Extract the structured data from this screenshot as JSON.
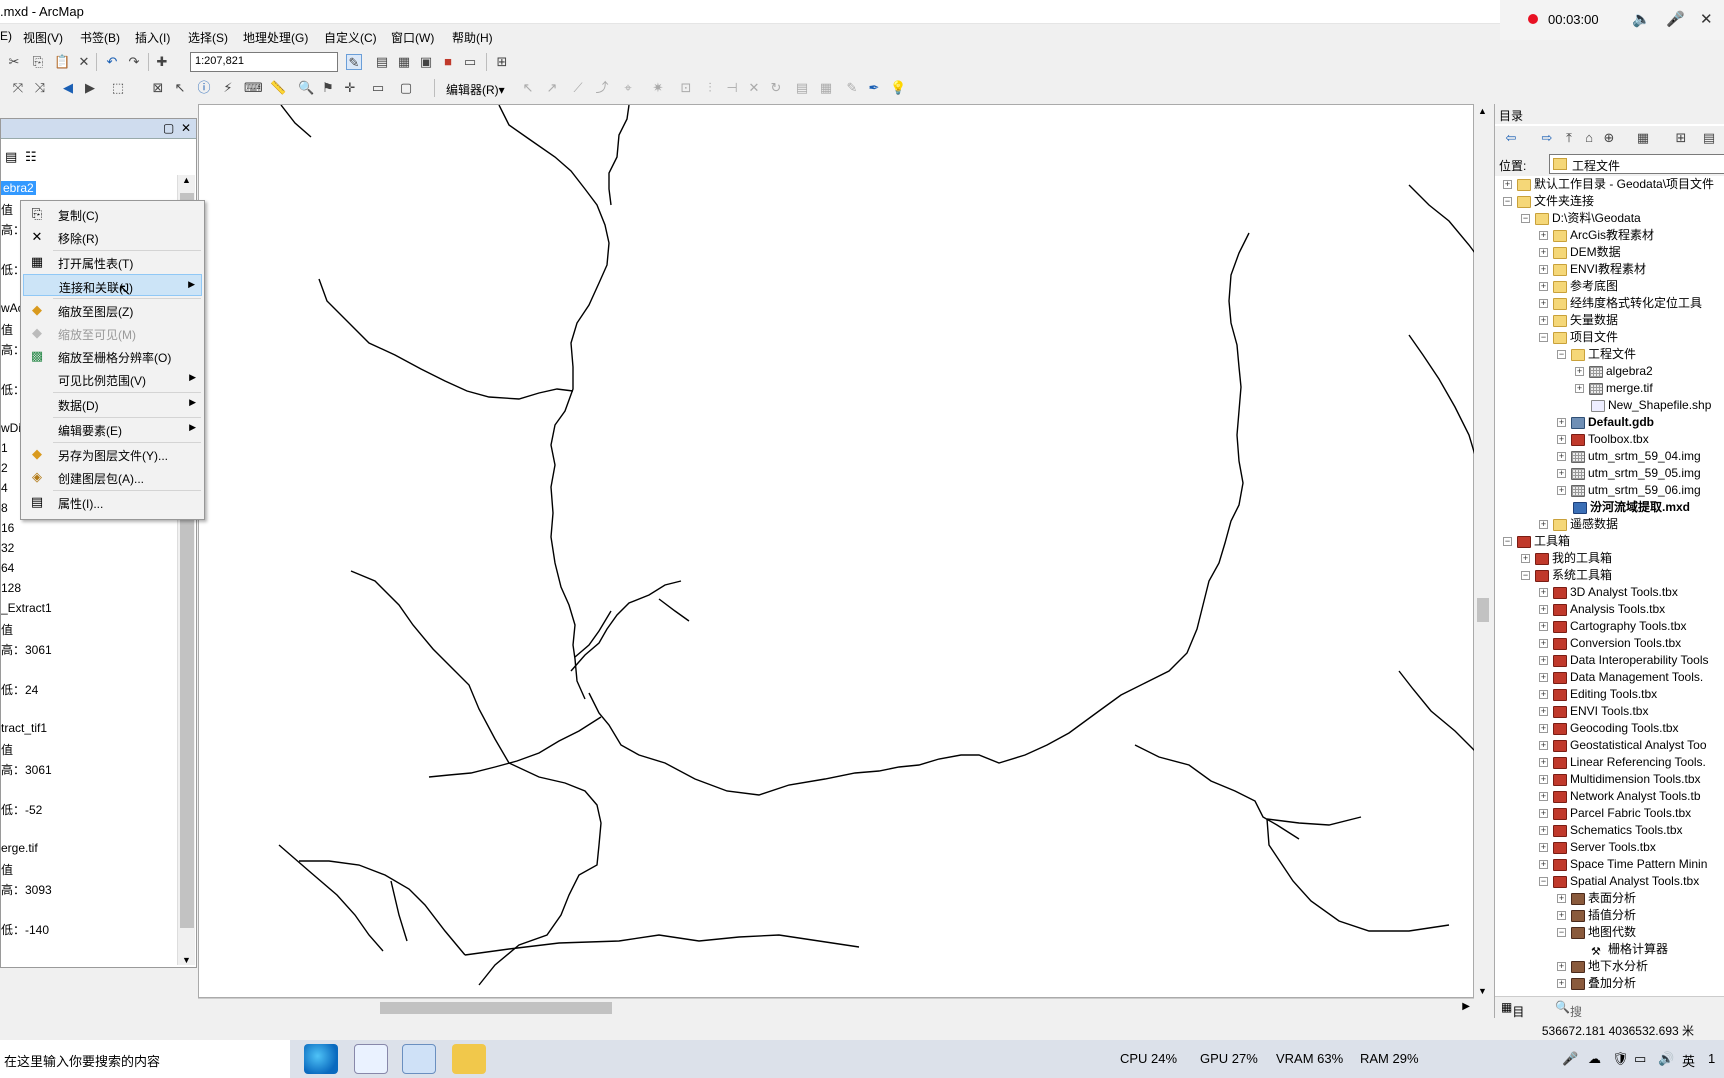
{
  "window": {
    "title": ".mxd - ArcMap"
  },
  "recorder": {
    "time": "00:03:00",
    "speaker_icon": "speaker-icon",
    "mic_icon": "microphone-icon",
    "close_icon": "close-icon"
  },
  "menu": [
    "E)",
    "视图(V)",
    "书签(B)",
    "插入(I)",
    "选择(S)",
    "地理处理(G)",
    "自定义(C)",
    "窗口(W)",
    "帮助(H)"
  ],
  "toolbar": {
    "scale": "1:207,821",
    "editor_label": "编辑器(R)▾"
  },
  "toc": {
    "lines": [
      "ebra2",
      "值",
      "高：",
      "低：",
      "wAc",
      "值",
      "高：",
      "低：",
      "wDi",
      "1",
      "2",
      "4",
      "8",
      "16",
      "32",
      "64",
      "128",
      "_Extract1",
      "值",
      "高：3061",
      "低：24",
      "tract_tif1",
      "值",
      "高：3061",
      "低：-52",
      "erge.tif",
      "值",
      "高：3093",
      "低：-140"
    ]
  },
  "context_menu": {
    "items": [
      {
        "label": "复制(C)",
        "icon": "copy-icon"
      },
      {
        "label": "移除(R)",
        "icon": "remove-icon"
      },
      {
        "label": "打开属性表(T)",
        "icon": "table-icon"
      },
      {
        "label": "连接和关联(J)",
        "icon": "",
        "submenu": true,
        "highlighted": true
      },
      {
        "label": "缩放至图层(Z)",
        "icon": "zoom-layer-icon"
      },
      {
        "label": "缩放至可见(M)",
        "icon": "zoom-visible-icon",
        "disabled": true
      },
      {
        "label": "缩放至栅格分辨率(O)",
        "icon": "zoom-raster-icon"
      },
      {
        "label": "可见比例范围(V)",
        "icon": "",
        "submenu": true
      },
      {
        "label": "数据(D)",
        "icon": "",
        "submenu": true
      },
      {
        "label": "编辑要素(E)",
        "icon": "",
        "submenu": true
      },
      {
        "label": "另存为图层文件(Y)...",
        "icon": "layer-file-icon"
      },
      {
        "label": "创建图层包(A)...",
        "icon": "layer-package-icon"
      },
      {
        "label": "属性(I)...",
        "icon": "properties-icon"
      }
    ]
  },
  "catalog": {
    "title": "目录",
    "location_label": "位置:",
    "location_value": "工程文件",
    "tree": [
      {
        "label": "默认工作目录 - Geodata\\项目文件",
        "level": 0,
        "toggle": "+",
        "icon": "fold"
      },
      {
        "label": "文件夹连接",
        "level": 0,
        "toggle": "-",
        "icon": "fold"
      },
      {
        "label": "D:\\资料\\Geodata",
        "level": 1,
        "toggle": "-",
        "icon": "fold"
      },
      {
        "label": "ArcGis教程素材",
        "level": 2,
        "toggle": "+",
        "icon": "fold"
      },
      {
        "label": "DEM数据",
        "level": 2,
        "toggle": "+",
        "icon": "fold"
      },
      {
        "label": "ENVI教程素材",
        "level": 2,
        "toggle": "+",
        "icon": "fold"
      },
      {
        "label": "参考底图",
        "level": 2,
        "toggle": "+",
        "icon": "fold"
      },
      {
        "label": "经纬度格式转化定位工具",
        "level": 2,
        "toggle": "+",
        "icon": "fold"
      },
      {
        "label": "矢量数据",
        "level": 2,
        "toggle": "+",
        "icon": "fold"
      },
      {
        "label": "项目文件",
        "level": 2,
        "toggle": "-",
        "icon": "fold"
      },
      {
        "label": "工程文件",
        "level": 3,
        "toggle": "-",
        "icon": "fold"
      },
      {
        "label": "algebra2",
        "level": 4,
        "toggle": "+",
        "icon": "ras"
      },
      {
        "label": "merge.tif",
        "level": 4,
        "toggle": "+",
        "icon": "ras"
      },
      {
        "label": "New_Shapefile.shp",
        "level": 4,
        "toggle": "",
        "icon": "shp"
      },
      {
        "label": "Default.gdb",
        "level": 3,
        "toggle": "+",
        "icon": "gdb",
        "bold": true
      },
      {
        "label": "Toolbox.tbx",
        "level": 3,
        "toggle": "+",
        "icon": "tbx"
      },
      {
        "label": "utm_srtm_59_04.img",
        "level": 3,
        "toggle": "+",
        "icon": "ras"
      },
      {
        "label": "utm_srtm_59_05.img",
        "level": 3,
        "toggle": "+",
        "icon": "ras"
      },
      {
        "label": "utm_srtm_59_06.img",
        "level": 3,
        "toggle": "+",
        "icon": "ras"
      },
      {
        "label": "汾河流域提取.mxd",
        "level": 3,
        "toggle": "",
        "icon": "mxd",
        "bold": true
      },
      {
        "label": "遥感数据",
        "level": 2,
        "toggle": "+",
        "icon": "fold"
      },
      {
        "label": "工具箱",
        "level": 0,
        "toggle": "-",
        "icon": "tbx"
      },
      {
        "label": "我的工具箱",
        "level": 1,
        "toggle": "+",
        "icon": "tbx"
      },
      {
        "label": "系统工具箱",
        "level": 1,
        "toggle": "-",
        "icon": "tbx"
      },
      {
        "label": "3D Analyst Tools.tbx",
        "level": 2,
        "toggle": "+",
        "icon": "tbx"
      },
      {
        "label": "Analysis Tools.tbx",
        "level": 2,
        "toggle": "+",
        "icon": "tbx"
      },
      {
        "label": "Cartography Tools.tbx",
        "level": 2,
        "toggle": "+",
        "icon": "tbx"
      },
      {
        "label": "Conversion Tools.tbx",
        "level": 2,
        "toggle": "+",
        "icon": "tbx"
      },
      {
        "label": "Data Interoperability Tools",
        "level": 2,
        "toggle": "+",
        "icon": "tbx"
      },
      {
        "label": "Data Management Tools.",
        "level": 2,
        "toggle": "+",
        "icon": "tbx"
      },
      {
        "label": "Editing Tools.tbx",
        "level": 2,
        "toggle": "+",
        "icon": "tbx"
      },
      {
        "label": "ENVI Tools.tbx",
        "level": 2,
        "toggle": "+",
        "icon": "tbx"
      },
      {
        "label": "Geocoding Tools.tbx",
        "level": 2,
        "toggle": "+",
        "icon": "tbx"
      },
      {
        "label": "Geostatistical Analyst Too",
        "level": 2,
        "toggle": "+",
        "icon": "tbx"
      },
      {
        "label": "Linear Referencing Tools.",
        "level": 2,
        "toggle": "+",
        "icon": "tbx"
      },
      {
        "label": "Multidimension Tools.tbx",
        "level": 2,
        "toggle": "+",
        "icon": "tbx"
      },
      {
        "label": "Network Analyst Tools.tb",
        "level": 2,
        "toggle": "+",
        "icon": "tbx"
      },
      {
        "label": "Parcel Fabric Tools.tbx",
        "level": 2,
        "toggle": "+",
        "icon": "tbx"
      },
      {
        "label": "Schematics Tools.tbx",
        "level": 2,
        "toggle": "+",
        "icon": "tbx"
      },
      {
        "label": "Server Tools.tbx",
        "level": 2,
        "toggle": "+",
        "icon": "tbx"
      },
      {
        "label": "Space Time Pattern Minin",
        "level": 2,
        "toggle": "+",
        "icon": "tbx"
      },
      {
        "label": "Spatial Analyst Tools.tbx",
        "level": 2,
        "toggle": "-",
        "icon": "tbx"
      },
      {
        "label": "表面分析",
        "level": 3,
        "toggle": "+",
        "icon": "tls"
      },
      {
        "label": "插值分析",
        "level": 3,
        "toggle": "+",
        "icon": "tls"
      },
      {
        "label": "地图代数",
        "level": 3,
        "toggle": "-",
        "icon": "tls"
      },
      {
        "label": "栅格计算器",
        "level": 4,
        "toggle": "",
        "icon": "ham"
      },
      {
        "label": "地下水分析",
        "level": 3,
        "toggle": "+",
        "icon": "tls"
      },
      {
        "label": "叠加分析",
        "level": 3,
        "toggle": "+",
        "icon": "tls"
      }
    ],
    "tabs": [
      "目录",
      "搜索"
    ]
  },
  "status": {
    "coordinates": "536672.181  4036532.693 米"
  },
  "taskbar": {
    "search_placeholder": "在这里输入你要搜索的内容",
    "cpu": "CPU  24%",
    "gpu": "GPU  27%",
    "vram": "VRAM  63%",
    "ram": "RAM  29%",
    "ime": "英",
    "clock": "1"
  }
}
